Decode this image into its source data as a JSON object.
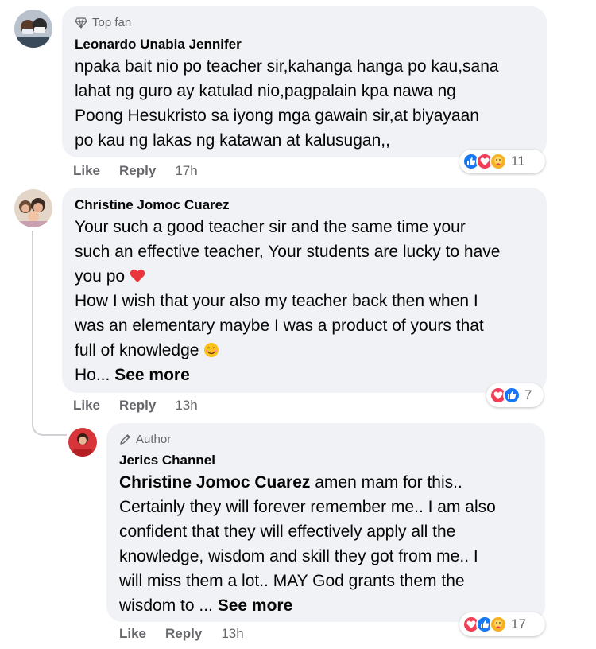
{
  "comments": [
    {
      "badge": "Top fan",
      "author": "Leonardo Unabia Jennifer",
      "lines": [
        "npaka bait nio po teacher sir,kahanga hanga po kau,sana",
        "lahat ng guro ay katulad nio,pagpalain kpa nawa ng",
        "Poong Hesukristo sa iyong mga gawain sir,at biyayaan",
        "po kau ng lakas ng katawan at kalusugan,,"
      ],
      "actions": {
        "like": "Like",
        "reply": "Reply",
        "time": "17h"
      },
      "reactions": {
        "count": "11",
        "icons": [
          "like-reaction-icon",
          "love-reaction-icon",
          "care-reaction-icon"
        ]
      }
    },
    {
      "author": "Christine Jomoc Cuarez",
      "lines": [
        "Your such a good teacher sir and the same time your",
        "such an effective teacher, Your students are lucky to have",
        "you po",
        "How I wish that your also my teacher back then when I",
        "was an elementary maybe I was a product of yours that",
        "full of knowledge",
        "Ho..."
      ],
      "see_more": "See more",
      "actions": {
        "like": "Like",
        "reply": "Reply",
        "time": "13h"
      },
      "reactions": {
        "count": "7",
        "icons": [
          "love-reaction-icon",
          "like-reaction-icon"
        ]
      }
    },
    {
      "badge": "Author",
      "author": "Jerics Channel",
      "mention": "Christine Jomoc Cuarez",
      "lines": [
        " amen mam for this..",
        "Certainly they will forever remember me.. I am also",
        "confident that they will effectively apply all the",
        "knowledge, wisdom and skill they got from me.. I",
        "will miss them a lot.. MAY God grants them the",
        "wisdom to ..."
      ],
      "see_more": "See more",
      "actions": {
        "like": "Like",
        "reply": "Reply",
        "time": "13h"
      },
      "reactions": {
        "count": "17",
        "icons": [
          "love-reaction-icon",
          "like-reaction-icon",
          "care-reaction-icon"
        ]
      }
    }
  ],
  "colors": {
    "like": "#1877f2",
    "love": "#f33e58",
    "care": "#f7b125",
    "bubble": "#f0f2f5",
    "secondary_text": "#65676b"
  }
}
